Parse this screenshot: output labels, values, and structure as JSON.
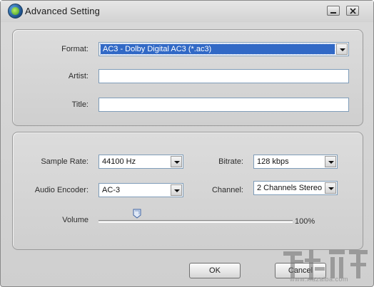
{
  "window": {
    "title": "Advanced  Setting",
    "minimize": "minimize",
    "close": "close"
  },
  "tags": {
    "format_label": "Format:",
    "format_value": "AC3 - Dolby Digital AC3 (*.ac3)",
    "artist_label": "Artist:",
    "artist_value": "",
    "title_label": "Title:",
    "title_value": ""
  },
  "audio": {
    "sample_rate_label": "Sample Rate:",
    "sample_rate_value": "44100 Hz",
    "bitrate_label": "Bitrate:",
    "bitrate_value": "128 kbps",
    "encoder_label": "Audio Encoder:",
    "encoder_value": "AC-3",
    "channel_label": "Channel:",
    "channel_value": "2 Channels Stereo",
    "volume_label": "Volume",
    "volume_value": "100%",
    "volume_fraction": 0.2
  },
  "buttons": {
    "ok": "OK",
    "cancel": "Cancel"
  },
  "watermark": {
    "site": "www.xiazaiba.com"
  },
  "icons": [
    "app-logo-icon",
    "minimize-icon",
    "close-icon",
    "dropdown-arrow-icon",
    "slider-thumb-icon"
  ],
  "colors": {
    "selection": "#3169c6",
    "field_border": "#7f9db9",
    "panel": "#d4d4d4"
  }
}
